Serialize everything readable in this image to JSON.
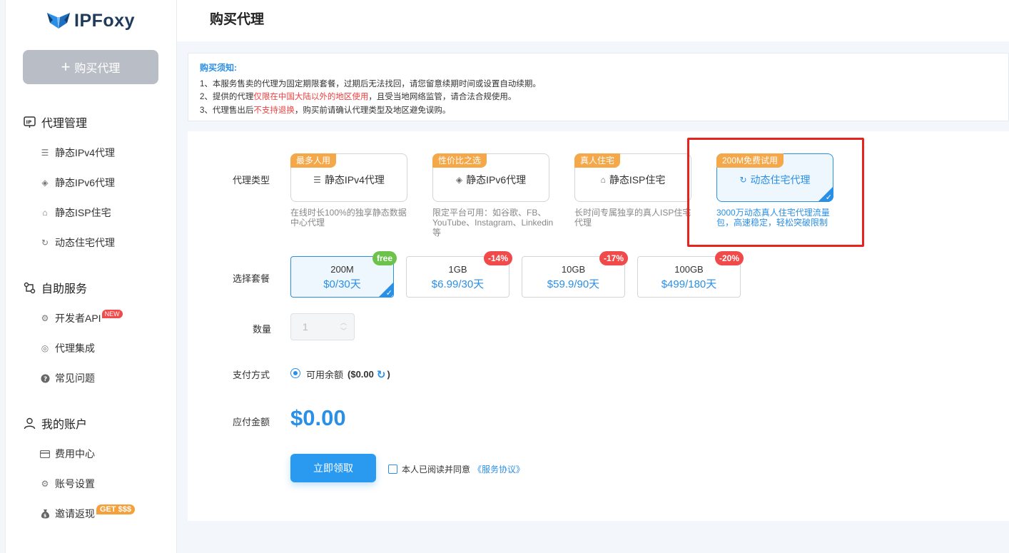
{
  "app": {
    "logo_text": "IPFoxy"
  },
  "sidebar": {
    "buy_button": "购买代理",
    "groups": [
      {
        "label": "代理管理",
        "items": [
          {
            "label": "静态IPv4代理"
          },
          {
            "label": "静态IPv6代理"
          },
          {
            "label": "静态ISP住宅"
          },
          {
            "label": "动态住宅代理"
          }
        ]
      },
      {
        "label": "自助服务",
        "items": [
          {
            "label": "开发者API",
            "badge": "NEW"
          },
          {
            "label": "代理集成"
          },
          {
            "label": "常见问题"
          }
        ]
      },
      {
        "label": "我的账户",
        "items": [
          {
            "label": "费用中心"
          },
          {
            "label": "账号设置"
          },
          {
            "label": "邀请返现",
            "badge": "GET $$$"
          }
        ]
      }
    ]
  },
  "page": {
    "title": "购买代理"
  },
  "notice": {
    "title": "购买须知:",
    "line1": "1、本服务售卖的代理为固定期限套餐，过期后无法找回，请您留意续期时间或设置自动续期。",
    "line2_a": "2、提供的代理",
    "line2_red": "仅限在中国大陆以外的地区使用",
    "line2_b": "，且受当地网络监管，请合法合规使用。",
    "line3_a": "3、代理售出后",
    "line3_red": "不支持退换",
    "line3_b": "，购买前请确认代理类型及地区避免误购。"
  },
  "form": {
    "type_label": "代理类型",
    "package_label": "选择套餐",
    "quantity_label": "数量",
    "payment_label": "支付方式",
    "amount_label": "应付金额"
  },
  "proxy_types": [
    {
      "tag": "最多人用",
      "label": "静态IPv4代理",
      "icon": "server-icon",
      "desc": "在线时长100%的独享静态数据中心代理"
    },
    {
      "tag": "性价比之选",
      "label": "静态IPv6代理",
      "icon": "layers-icon",
      "desc": "限定平台可用：如谷歌、FB、YouTube、Instagram、Linkedin等"
    },
    {
      "tag": "真人住宅",
      "label": "静态ISP住宅",
      "icon": "home-icon",
      "desc": "长时间专属独享的真人ISP住宅代理"
    },
    {
      "tag": "200M免费试用",
      "label": "动态住宅代理",
      "icon": "refresh-icon",
      "desc": "3000万动态真人住宅代理流量包，高速稳定，轻松突破限制",
      "selected": true
    }
  ],
  "packages": [
    {
      "name": "200M",
      "price": "$0/30天",
      "badge": "free",
      "selected": true
    },
    {
      "name": "1GB",
      "price": "$6.99/30天",
      "badge": "-14%"
    },
    {
      "name": "10GB",
      "price": "$59.9/90天",
      "badge": "-17%"
    },
    {
      "name": "100GB",
      "price": "$499/180天",
      "badge": "-20%"
    }
  ],
  "quantity": {
    "value": "1"
  },
  "payment": {
    "option": "可用余额",
    "balance": "($0.00",
    "close": ")"
  },
  "amount": {
    "value": "$0.00"
  },
  "actions": {
    "claim": "立即领取",
    "agree_text": "本人已阅读并同意",
    "agreement_link": "《服务协议》"
  },
  "colors": {
    "accent": "#2a8fe6",
    "tag_orange": "#f5a84a",
    "badge_red": "#f04a4a",
    "badge_green": "#6cc24a",
    "highlight_box": "#e8231e"
  }
}
